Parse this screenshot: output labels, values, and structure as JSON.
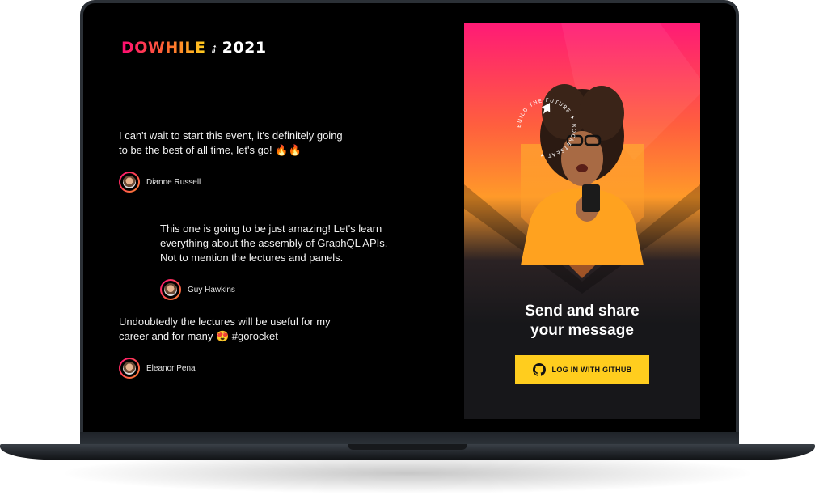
{
  "logo": {
    "brand_text": "DOWHILE",
    "year_text": "2021",
    "rocket_icon": "rocket-icon"
  },
  "messages": [
    {
      "text": "I can't wait to start this event, it's definitely going to be the best of all time, let's go! 🔥🔥",
      "author": "Dianne Russell"
    },
    {
      "text": "This one is going to be just amazing! Let's learn everything about the assembly of GraphQL APIs. Not to mention the lectures and panels.",
      "author": "Guy Hawkins"
    },
    {
      "text": "Undoubtedly the lectures will be useful for my career and for many 😍 #gorocket",
      "author": "Eleanor Pena"
    }
  ],
  "panel": {
    "badge_text": "BUILD THE FUTURE ✦ ROCKETSEAT ✦",
    "title_line1": "Send and share",
    "title_line2": "your message",
    "login_label": "LOG IN WITH GITHUB",
    "login_icon": "github-icon"
  },
  "colors": {
    "accent_pink": "#ff0a73",
    "accent_orange": "#ff8a2f",
    "accent_yellow": "#ffcd1e",
    "background": "#000000",
    "panel_dark": "#17171a"
  }
}
